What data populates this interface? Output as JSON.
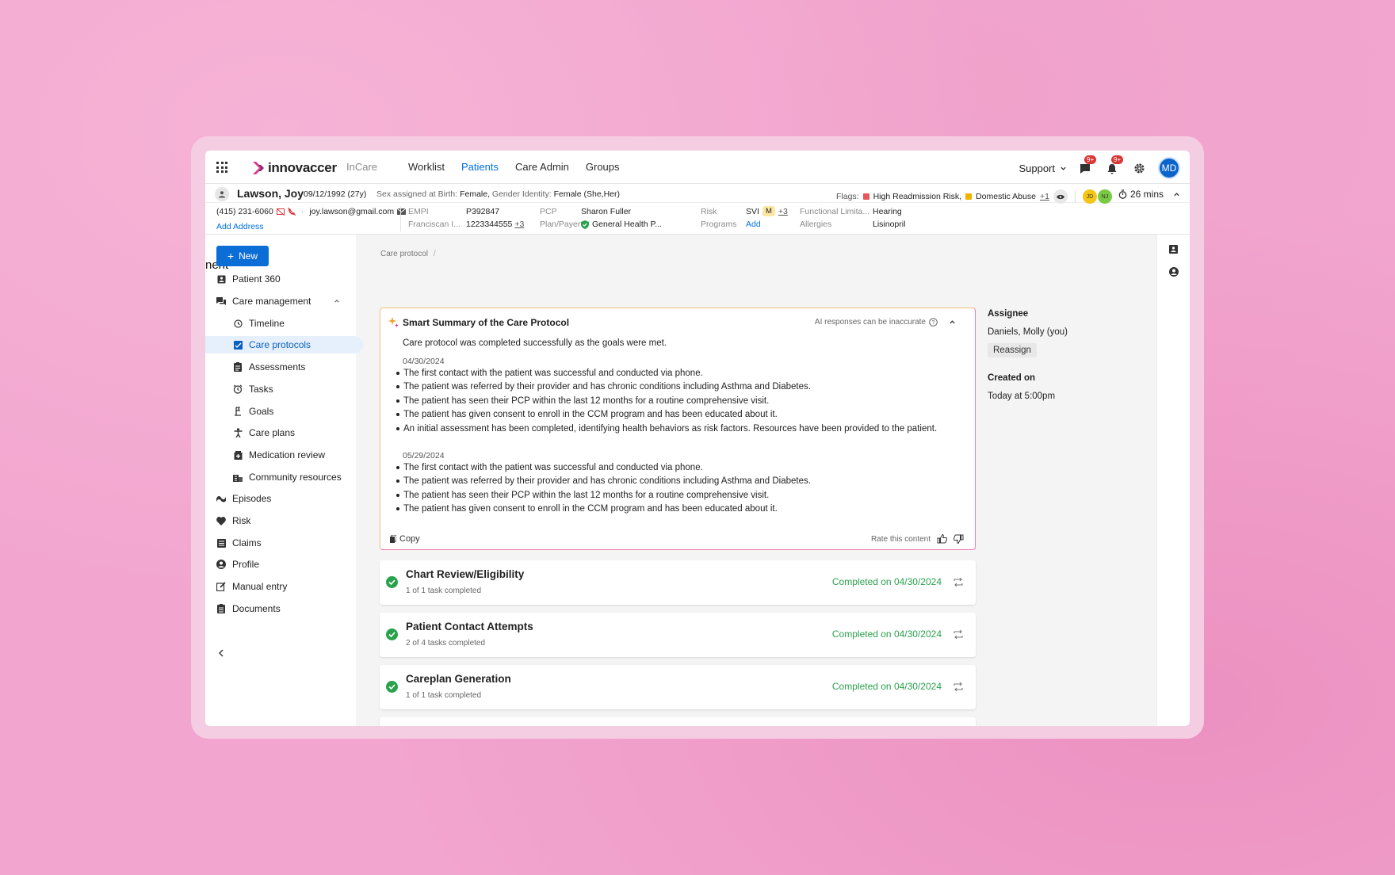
{
  "nav": {
    "brand": "innovaccer",
    "product": "InCare",
    "links": [
      {
        "label": "Worklist",
        "active": false
      },
      {
        "label": "Patients",
        "active": true
      },
      {
        "label": "Care Admin",
        "active": false
      },
      {
        "label": "Groups",
        "active": false
      }
    ],
    "support_label": "Support",
    "chat_badge": "9+",
    "notif_badge": "9+",
    "user_initials": "MD",
    "accent_color": "#0070dd"
  },
  "patient": {
    "name": "Lawson, Joy",
    "dob": "09/12/1992 (27y)",
    "sex_label": "Sex assigned at Birth:",
    "sex_value": "Female,",
    "gender_label": "Gender Identity:",
    "gender_value": "Female (She,Her)",
    "flags_label": "Flags:",
    "flag1": "High Readmission Risk,",
    "flag2": "Domestic Abuse",
    "flag_more": "+1",
    "care_team": [
      "JD",
      "NJ"
    ],
    "timer": "26 mins",
    "phone": "(415) 231-6060",
    "email": "joy.lawson@gmail.com",
    "add_address": "Add Address",
    "fields": {
      "empi_k": "EMPI",
      "empi_v": "P392847",
      "franciscan_k": "Franciscan I...",
      "franciscan_v": "1223344555",
      "franciscan_more": "+3",
      "pcp_k": "PCP",
      "pcp_v": "Sharon Fuller",
      "plan_k": "Plan/Payer",
      "plan_v": "General Health P...",
      "risk_k": "Risk",
      "risk_v": "SVI",
      "risk_badge": "M",
      "risk_more": "+3",
      "programs_k": "Programs",
      "programs_v": "Add",
      "func_k": "Functional Limita...",
      "func_v": "Hearing",
      "allergies_k": "Allergies",
      "allergies_v": "Lisinopril"
    }
  },
  "sidebar": {
    "new_label": "New",
    "clipped_title": "nent",
    "items": [
      {
        "label": "Patient 360",
        "icon": "id-card-icon"
      },
      {
        "label": "Care management",
        "icon": "chat-forum-icon"
      },
      {
        "label": "Timeline",
        "icon": "history-icon"
      },
      {
        "label": "Care protocols",
        "icon": "protocol-icon"
      },
      {
        "label": "Assessments",
        "icon": "clipboard-icon"
      },
      {
        "label": "Tasks",
        "icon": "alarm-icon"
      },
      {
        "label": "Goals",
        "icon": "goal-flag-icon"
      },
      {
        "label": "Care plans",
        "icon": "person-icon"
      },
      {
        "label": "Medication review",
        "icon": "medication-icon"
      },
      {
        "label": "Community resources",
        "icon": "building-icon"
      },
      {
        "label": "Episodes",
        "icon": "episodes-icon"
      },
      {
        "label": "Risk",
        "icon": "heart-icon"
      },
      {
        "label": "Claims",
        "icon": "list-icon"
      },
      {
        "label": "Profile",
        "icon": "profile-icon"
      },
      {
        "label": "Manual entry",
        "icon": "edit-icon"
      },
      {
        "label": "Documents",
        "icon": "document-icon"
      }
    ]
  },
  "breadcrumb": "Care protocol",
  "summary": {
    "title": "Smart Summary of the Care Protocol",
    "disclaimer": "AI responses can be inaccurate",
    "lead": "Care protocol was completed successfully as the goals were met.",
    "groups": [
      {
        "date": "04/30/2024",
        "bullets": [
          "The first contact with the patient was successful and conducted via phone.",
          "The patient was referred by their provider and has chronic conditions including Asthma and Diabetes.",
          "The patient has seen their PCP within the last 12 months for a routine comprehensive visit.",
          "The patient has given consent to enroll in the CCM program and has been educated about it.",
          "An initial assessment has been completed, identifying health behaviors as risk factors. Resources have been provided to the patient."
        ]
      },
      {
        "date": "05/29/2024",
        "bullets": [
          "The first contact with the patient was successful and conducted via phone.",
          "The patient was referred by their provider and has chronic conditions including Asthma and Diabetes.",
          "The patient has seen their PCP within the last 12 months for a routine comprehensive visit.",
          "The patient has given consent to enroll in the CCM program and has been educated about it."
        ]
      }
    ],
    "copy_label": "Copy",
    "rate_label": "Rate this content"
  },
  "tasks": [
    {
      "title": "Chart Review/Eligibility",
      "sub": "1 of 1 task completed",
      "status": "Completed on 04/30/2024"
    },
    {
      "title": "Patient Contact Attempts",
      "sub": "2 of 4 tasks completed",
      "status": "Completed on 04/30/2024"
    },
    {
      "title": "Careplan Generation",
      "sub": "1 of 1 task completed",
      "status": "Completed on 04/30/2024"
    }
  ],
  "details": {
    "assignee_label": "Assignee",
    "assignee_value": "Daniels, Molly (you)",
    "reassign_label": "Reassign",
    "created_label": "Created on",
    "created_value": "Today at 5:00pm"
  }
}
